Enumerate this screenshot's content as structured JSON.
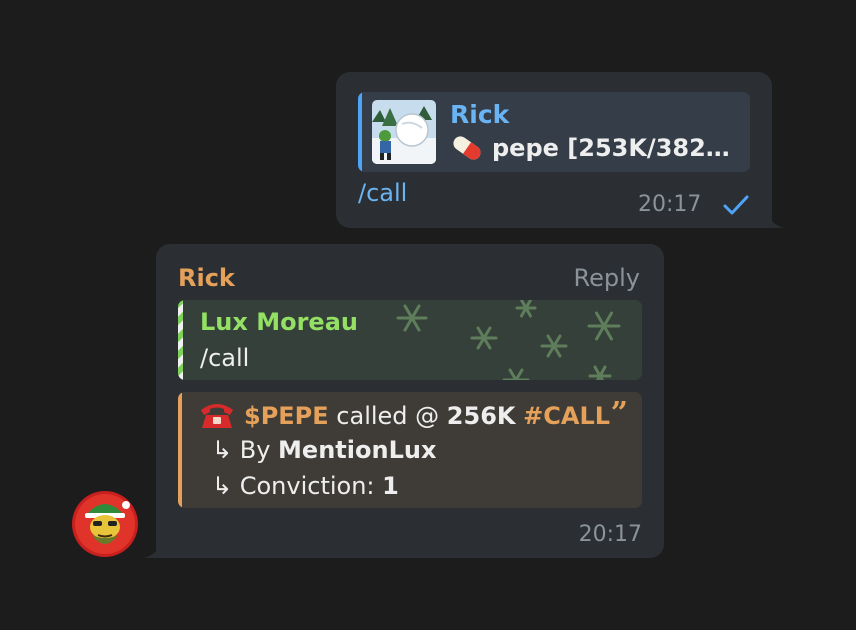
{
  "outgoing": {
    "reply_sender": "Rick",
    "reply_preview": "pepe [253K/382%...",
    "text": "/call",
    "time": "20:17",
    "status_icon": "single-check-icon"
  },
  "incoming": {
    "sender": "Rick",
    "reply_button": "Reply",
    "quote": {
      "name": "Lux Moreau",
      "text": "/call"
    },
    "call": {
      "ticker": "$PEPE",
      "called_text": " called @ ",
      "price": "256K",
      "tag": "#CALL",
      "by_prefix": "↳ By ",
      "by_name": "MentionLux",
      "conviction_prefix": "↳ Conviction: ",
      "conviction_value": "1",
      "quote_mark": "”"
    },
    "time": "20:17"
  },
  "colors": {
    "background": "#1c1c1d",
    "bubble": "#2b2f33",
    "link_blue": "#6ab4f3",
    "orange": "#e5a05a",
    "green": "#93e065",
    "muted": "#8a929a"
  }
}
